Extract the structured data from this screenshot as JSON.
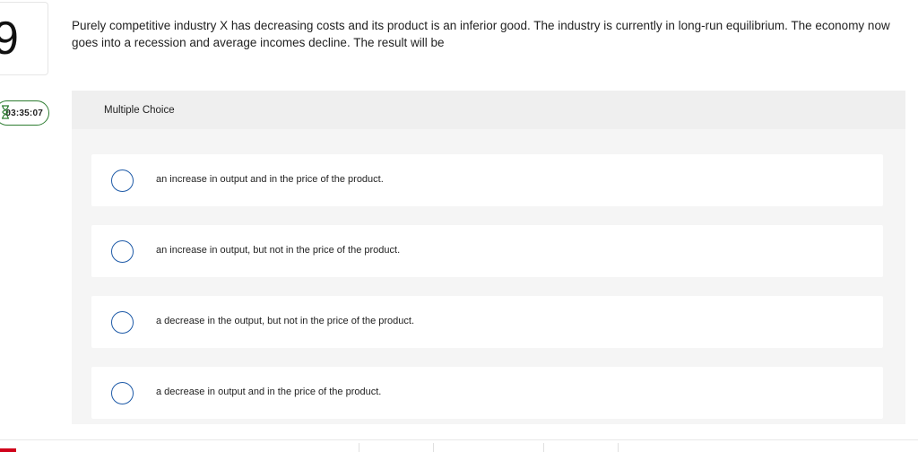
{
  "question": {
    "number": "9",
    "timer": "03:35:07",
    "text": "Purely competitive industry X has decreasing costs and its product is an inferior good. The industry is currently in long-run equilibrium. The economy now goes into a recession and average incomes decline. The result will be"
  },
  "multiple_choice": {
    "header": "Multiple Choice",
    "options": [
      {
        "label": "an increase in output and in the price of the product."
      },
      {
        "label": "an increase in output, but not in the price of the product."
      },
      {
        "label": "a decrease in the output, but not in the price of the product."
      },
      {
        "label": "a decrease in output and in the price of the product."
      }
    ]
  },
  "colors": {
    "timer_border": "#2e7d32",
    "radio_border": "#1f5ba8",
    "panel_bg": "#f5f5f5",
    "accent_red": "#d0021b"
  },
  "icons": {
    "timer": "hourglass-icon"
  }
}
